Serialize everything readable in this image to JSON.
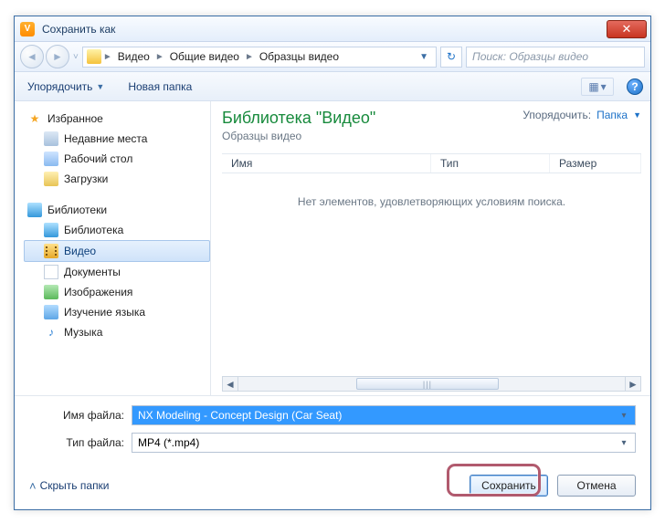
{
  "window": {
    "title": "Сохранить как",
    "close_glyph": "✕"
  },
  "nav": {
    "back_glyph": "◄",
    "fwd_glyph": "►",
    "history_glyph": "˅",
    "breadcrumb": {
      "seg1": "Видео",
      "seg2": "Общие видео",
      "seg3": "Образцы видео",
      "sep": "►",
      "drop": "▼"
    },
    "refresh_glyph": "↻",
    "search_placeholder": "Поиск: Образцы видео"
  },
  "toolbar": {
    "organize": "Упорядочить",
    "new_folder": "Новая папка",
    "views_glyph": "▦",
    "views_drop": "▾",
    "help_glyph": "?"
  },
  "sidebar": {
    "favorites": "Избранное",
    "fav_items": {
      "recent": "Недавние места",
      "desktop": "Рабочий стол",
      "downloads": "Загрузки"
    },
    "libraries": "Библиотеки",
    "lib_items": {
      "library": "Библиотека",
      "videos": "Видео",
      "documents": "Документы",
      "pictures": "Изображения",
      "language": "Изучение языка",
      "music": "Музыка"
    }
  },
  "pane": {
    "lib_title": "Библиотека \"Видео\"",
    "lib_sub": "Образцы видео",
    "sort_label": "Упорядочить:",
    "sort_value": "Папка",
    "sort_drop": "▼",
    "columns": {
      "name": "Имя",
      "type": "Тип",
      "size": "Размер"
    },
    "empty_msg": "Нет элементов, удовлетворяющих условиям поиска.",
    "scroll_thumb": "|||",
    "scroll_left": "◄",
    "scroll_right": "►"
  },
  "form": {
    "filename_label": "Имя файла:",
    "filename_value": "NX Modeling - Concept Design (Car Seat)",
    "filetype_label": "Тип файла:",
    "filetype_value": "MP4 (*.mp4)",
    "drop": "▾"
  },
  "buttons": {
    "hide_folders": "Скрыть папки",
    "hide_chev": "˄",
    "save": "Сохранить",
    "cancel": "Отмена"
  }
}
